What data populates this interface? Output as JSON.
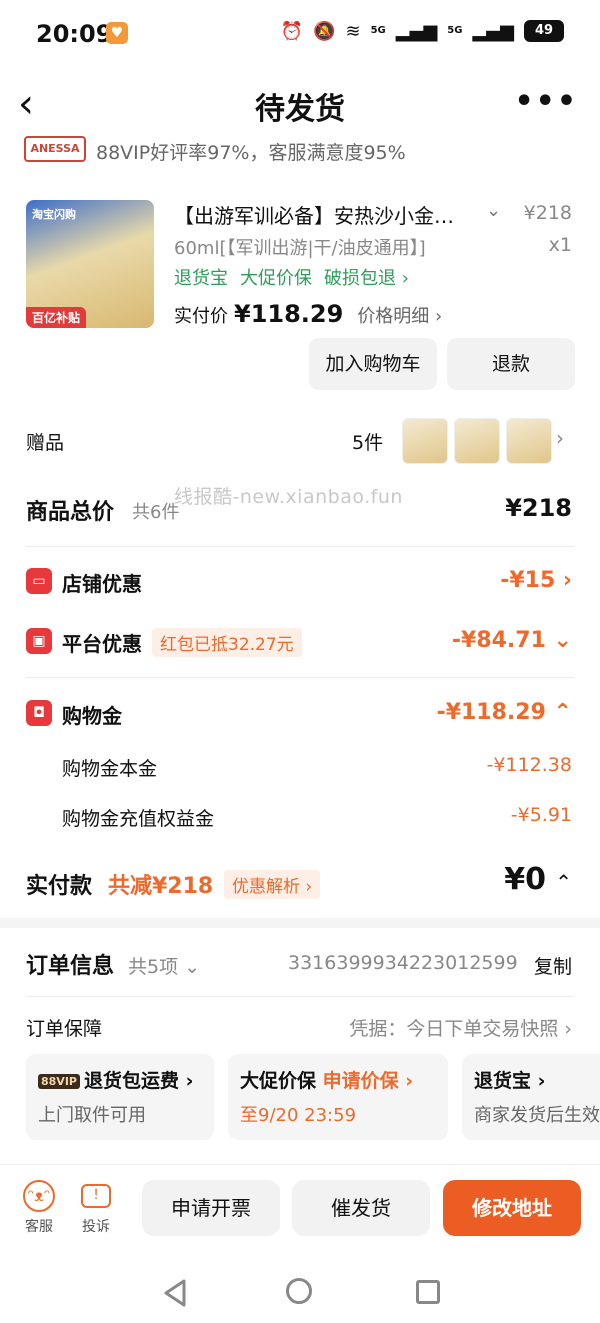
{
  "status_bar": {
    "time": "20:09",
    "app_icon": "heart-app-icon",
    "signal_1": "5G",
    "signal_2": "5G",
    "battery": "49"
  },
  "nav": {
    "back_icon": "‹",
    "title": "待发货",
    "more_icon": "•••"
  },
  "shop": {
    "logo_text": "ANESSA",
    "rating_text": "88VIP好评率97%，客服满意度95%"
  },
  "product": {
    "image_badge": "百亿补贴",
    "image_top_text": "淘宝闪购",
    "title": "【出游军训必备】安热沙小金瓶防晒",
    "price": "¥218",
    "spec": "60ml[【军训出游|干/油皮通用】]",
    "qty": "x1",
    "tags": [
      "退货宝",
      "大促价保",
      "破损包退 ›"
    ],
    "paid_label": "实付价",
    "paid_value": "¥118.29",
    "breakdown_label": "价格明细 ›",
    "add_to_cart": "加入购物车",
    "refund": "退款"
  },
  "gift": {
    "label": "赠品",
    "count": "5件",
    "chevron": "›"
  },
  "watermark": "线报酷-new.xianbao.fun",
  "totals": {
    "label": "商品总价",
    "count": "共6件",
    "value": "¥218"
  },
  "discounts": {
    "shop": {
      "label": "店铺优惠",
      "value": "-¥15 ›"
    },
    "platform": {
      "label": "平台优惠",
      "redpack": "红包已抵32.27元",
      "value": "-¥84.71 ⌄"
    },
    "credit": {
      "label": "购物金",
      "value": "-¥118.29 ⌃",
      "principal_label": "购物金本金",
      "principal_value": "-¥112.38",
      "bonus_label": "购物金充值权益金",
      "bonus_value": "-¥5.91"
    }
  },
  "payment": {
    "label": "实付款",
    "saved": "共减¥218",
    "analysis": "优惠解析 ›",
    "value": "¥0",
    "chevron": "⌃"
  },
  "order": {
    "label": "订单信息",
    "count": "共5项 ⌄",
    "id": "3316399934223012599",
    "copy": "复制",
    "guarantee_label": "订单保障",
    "proof": "凭据：今日下单交易快照 ›",
    "cards": [
      {
        "badge": "88VIP",
        "title": "退货包运费 ›",
        "sub": "上门取件可用"
      },
      {
        "title": "大促价保",
        "action": "申请价保 ›",
        "sub": "至9/20 23:59"
      },
      {
        "title": "退货宝 ›",
        "sub": "商家发货后生效"
      }
    ]
  },
  "bottom": {
    "service": "客服",
    "complaint": "投诉",
    "invoice": "申请开票",
    "urge": "催发货",
    "change_address": "修改地址"
  },
  "colors": {
    "accent_orange": "#ec6a2c",
    "primary_button": "#ec5d24",
    "discount_red_icon": "#e7383b",
    "tag_green": "#2d9e5a"
  }
}
